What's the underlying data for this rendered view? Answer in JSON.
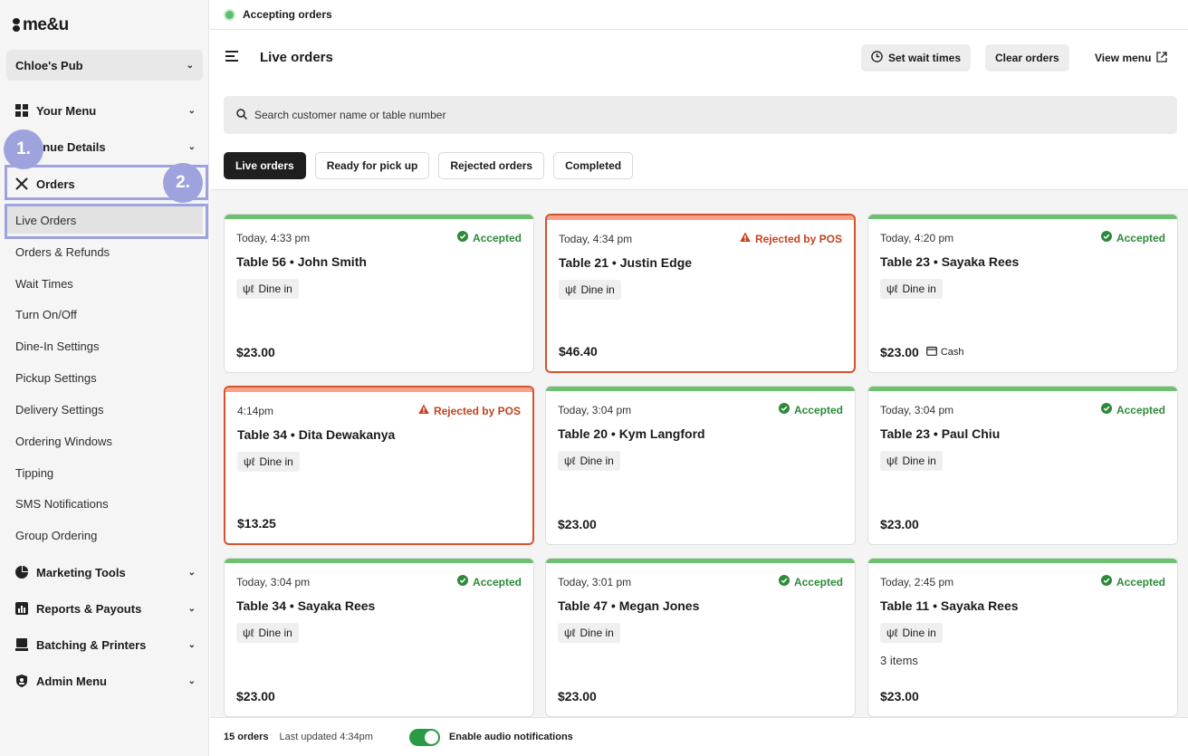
{
  "app": {
    "logo": "me&u"
  },
  "sidebar": {
    "venue": "Chloe's Pub",
    "sections": [
      {
        "label": "Your Menu",
        "icon": "grid-icon"
      },
      {
        "label": "Venue Details",
        "icon": "store-icon"
      },
      {
        "label": "Orders",
        "icon": "cutlery-icon"
      }
    ],
    "orders_items": [
      "Live Orders",
      "Orders & Refunds",
      "Wait Times",
      "Turn On/Off",
      "Dine-In Settings",
      "Pickup Settings",
      "Delivery Settings",
      "Ordering Windows",
      "Tipping",
      "SMS Notifications",
      "Group Ordering"
    ],
    "bottom_sections": [
      {
        "label": "Marketing Tools",
        "icon": "pie-chart-icon"
      },
      {
        "label": "Reports & Payouts",
        "icon": "bar-chart-icon"
      },
      {
        "label": "Batching & Printers",
        "icon": "printer-icon"
      },
      {
        "label": "Admin Menu",
        "icon": "shield-icon"
      }
    ],
    "venue_details_visible": "enue Details",
    "step1": "1.",
    "step2": "2."
  },
  "status_bar": {
    "text": "Accepting orders",
    "color": "#5cbf6e"
  },
  "header": {
    "title": "Live orders",
    "set_wait_times": "Set wait times",
    "clear_orders": "Clear orders",
    "view_menu": "View menu"
  },
  "search": {
    "placeholder": "Search customer name or table number"
  },
  "tabs": [
    "Live orders",
    "Ready for pick up",
    "Rejected orders",
    "Completed"
  ],
  "orders": [
    {
      "time": "Today, 4:33 pm",
      "status": "Accepted",
      "table": "Table 56",
      "name": "John Smith",
      "type": "Dine in",
      "price": "$23.00",
      "items": "",
      "payment": ""
    },
    {
      "time": "Today, 4:34 pm",
      "status": "Rejected by POS",
      "table": "Table 21",
      "name": "Justin Edge",
      "type": "Dine in",
      "price": "$46.40",
      "items": "",
      "payment": ""
    },
    {
      "time": "Today, 4:20 pm",
      "status": "Accepted",
      "table": "Table 23",
      "name": "Sayaka Rees",
      "type": "Dine in",
      "price": "$23.00",
      "items": "",
      "payment": "Cash"
    },
    {
      "time": "4:14pm",
      "status": "Rejected by POS",
      "table": "Table 34",
      "name": "Dita Dewakanya",
      "type": "Dine in",
      "price": "$13.25",
      "items": "",
      "payment": ""
    },
    {
      "time": "Today, 3:04 pm",
      "status": "Accepted",
      "table": "Table 20",
      "name": "Kym Langford",
      "type": "Dine in",
      "price": "$23.00",
      "items": "",
      "payment": ""
    },
    {
      "time": "Today, 3:04 pm",
      "status": "Accepted",
      "table": "Table 23",
      "name": "Paul Chiu",
      "type": "Dine in",
      "price": "$23.00",
      "items": "",
      "payment": ""
    },
    {
      "time": "Today, 3:04 pm",
      "status": "Accepted",
      "table": "Table 34",
      "name": "Sayaka Rees",
      "type": "Dine in",
      "price": "$23.00",
      "items": "",
      "payment": ""
    },
    {
      "time": "Today, 3:01 pm",
      "status": "Accepted",
      "table": "Table 47",
      "name": "Megan Jones",
      "type": "Dine in",
      "price": "$23.00",
      "items": "",
      "payment": ""
    },
    {
      "time": "Today, 2:45 pm",
      "status": "Accepted",
      "table": "Table 11",
      "name": "Sayaka Rees",
      "type": "Dine in",
      "price": "$23.00",
      "items": "3 items",
      "payment": ""
    }
  ],
  "footer": {
    "count": "15 orders",
    "updated": "Last updated 4:34pm",
    "audio": "Enable audio notifications",
    "audio_enabled": true
  },
  "colors": {
    "accepted": "#2d8a3a",
    "rejected": "#c4421d",
    "highlight": "#9ea3dd"
  }
}
